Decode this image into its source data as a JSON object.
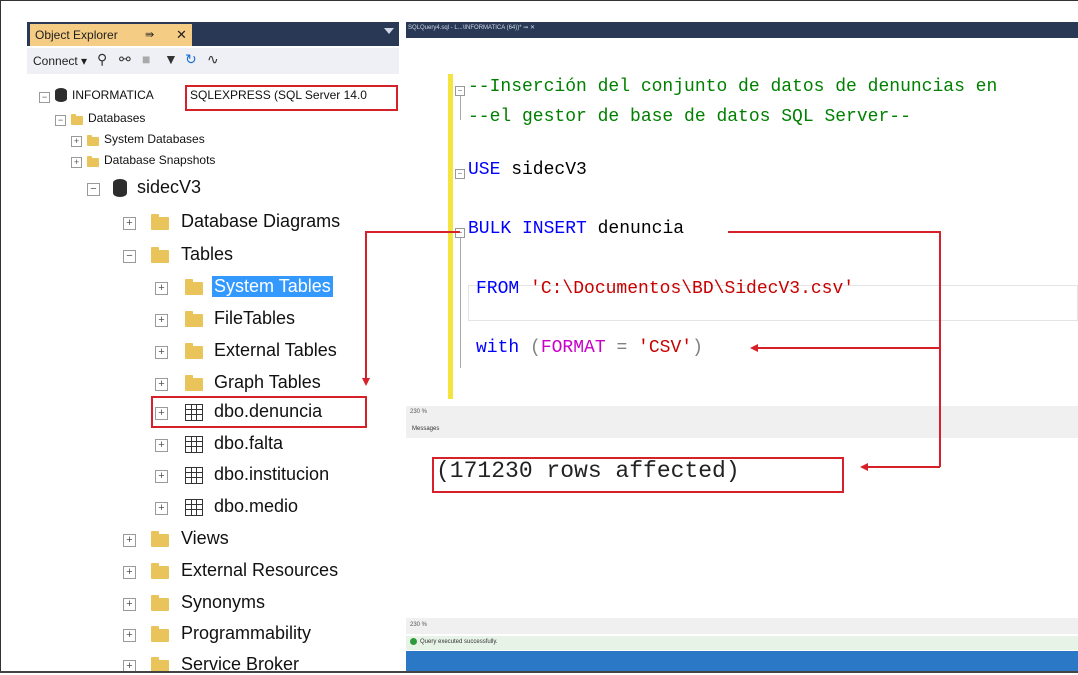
{
  "object_explorer": {
    "title": "Object Explorer",
    "pin_glyph": "⇛",
    "close_glyph": "✕",
    "connect_label": "Connect ▾",
    "server": {
      "name_part": "INFORMATICA",
      "instance_part": "SQLEXPRESS (SQL Server 14.0"
    },
    "databases_label": "Databases",
    "system_databases_label": "System Databases",
    "database_snapshots_label": "Database Snapshots",
    "database_name": "sidecV3",
    "db_children_top": [
      {
        "label": "Database Diagrams"
      },
      {
        "label": "Tables"
      }
    ],
    "table_folders": [
      {
        "label": "System Tables"
      },
      {
        "label": "FileTables"
      },
      {
        "label": "External Tables"
      },
      {
        "label": "Graph Tables"
      }
    ],
    "tables": [
      {
        "label": "dbo.denuncia"
      },
      {
        "label": "dbo.falta"
      },
      {
        "label": "dbo.institucion"
      },
      {
        "label": "dbo.medio"
      }
    ],
    "db_children_bottom": [
      {
        "label": "Views"
      },
      {
        "label": "External Resources"
      },
      {
        "label": "Synonyms"
      },
      {
        "label": "Programmability"
      },
      {
        "label": "Service Broker"
      }
    ]
  },
  "editor": {
    "tab_label": "SQLQuery4.sql - L...\\INFORMATICA (64))*  ⇛  ✕",
    "comment_line_1": "--Inserción del conjunto de datos de denuncias en",
    "comment_line_2": "--el gestor de base de datos SQL Server--",
    "use_kw": "USE",
    "use_db": " sidecV3",
    "bulk_kw": "BULK INSERT",
    "bulk_table": " denuncia",
    "from_kw": "FROM",
    "from_path": " 'C:\\Documentos\\BD\\SidecV3.csv'",
    "with_kw": "with",
    "with_open": " (",
    "format_kw": "FORMAT",
    "format_eq": " = ",
    "format_val": "'CSV'",
    "with_close": ")",
    "zoom_label_1": "230 %",
    "messages_tab": "Messages",
    "rows_affected": "(171230 rows affected)",
    "zoom_label_2": "230 %",
    "status_text": "Query executed successfully."
  },
  "annotation_color": "#d6202a"
}
